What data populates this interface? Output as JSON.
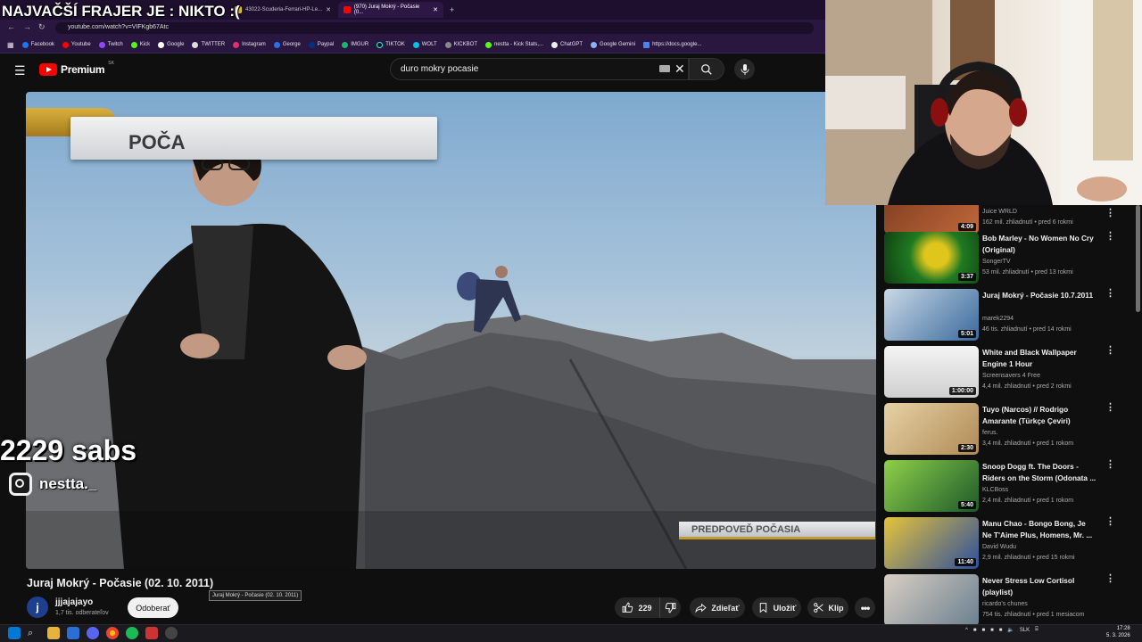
{
  "stream": {
    "title": "NAJVAČŠÍ FRAJER JE : NIKTO :(",
    "subs_counter": "2229 sabs",
    "instagram": "nestta._"
  },
  "browser": {
    "tabs": [
      {
        "label": "43022-Scuderia-Ferrari-HP-Le..."
      },
      {
        "label": "(970) Juraj Mokrý - Počasie (0..."
      }
    ],
    "url": "youtube.com/watch?v=VIFKgb67Atc",
    "bookmarks": [
      "Facebook",
      "Youtube",
      "Twitch",
      "Kick",
      "Google",
      "TWITTER",
      "Instagram",
      "George",
      "Paypal",
      "IMGUR",
      "TIKTOK",
      "WOLT",
      "KICKBOT",
      "nestta - Kick Stats,...",
      "ChatGPT",
      "Google Gemini",
      "https://docs.google..."
    ]
  },
  "youtube": {
    "logo": "Premium",
    "country": "SK",
    "search_query": "duro mokry pocasie"
  },
  "video": {
    "overlay_title": "POČA",
    "forecast_tag": "PREDPOVEĎ POČASIA",
    "title": "Juraj Mokrý - Počasie (02. 10. 2011)",
    "tooltip": "Juraj Mokrý - Počasie (02. 10. 2011)",
    "channel_initial": "j",
    "channel": "jjjajajayo",
    "channel_subs": "1,7 tis. odberateľov",
    "subscribe": "Odoberať",
    "likes": "229",
    "share": "Zdieľať",
    "save": "Uložiť",
    "clip": "Klip"
  },
  "sidebar": [
    {
      "title": "",
      "channel": "Juice WRLD",
      "meta": "162 mil. zhliadnutí • pred 6 rokmi",
      "duration": "4:09",
      "colors": [
        "#7a3b1f",
        "#c1683a"
      ]
    },
    {
      "title": "Bob Marley - No Women No Cry (Original)",
      "channel": "SongerTV",
      "meta": "53 mil. zhliadnutí • pred 13 rokmi",
      "duration": "3:37",
      "colors": [
        "#1f7a22",
        "#e0c51c"
      ]
    },
    {
      "title": "Juraj Mokrý - Počasie 10.7.2011",
      "channel": "marek2294",
      "meta": "46 tis. zhliadnutí • pred 14 rokmi",
      "duration": "5:01",
      "colors": [
        "#3a6a9c",
        "#c9d8e6"
      ]
    },
    {
      "title": "White and Black Wallpaper Engine 1 Hour",
      "channel": "Screensavers 4 Free",
      "meta": "4,4 mil. zhliadnutí • pred 2 rokmi",
      "duration": "1:00:00",
      "colors": [
        "#d8d8d8",
        "#f4f4f4"
      ]
    },
    {
      "title": "Tuyo (Narcos) // Rodrigo Amarante (Türkçe Çeviri)",
      "channel": "ferus.",
      "meta": "3,4 mil. zhliadnutí • pred 1 rokom",
      "duration": "2:30",
      "colors": [
        "#b08a55",
        "#e6d2a5"
      ]
    },
    {
      "title": "Snoop Dogg ft. The Doors - Riders on the Storm (Odonata ...",
      "channel": "KLCBoss",
      "meta": "2,4 mil. zhliadnutí • pred 1 rokom",
      "duration": "5:40",
      "colors": [
        "#1c5a2a",
        "#8fd04a"
      ]
    },
    {
      "title": "Manu Chao - Bongo Bong, Je Ne T'Aime Plus, Homens, Mr. ...",
      "channel": "David Wudu",
      "meta": "2,9 mil. zhliadnutí • pred 15 rokmi",
      "duration": "11:40",
      "colors": [
        "#2f4f9c",
        "#e5c43a"
      ]
    },
    {
      "title": "Never Stress Low Cortisol (playlist)",
      "channel": "ricardo's chunes",
      "meta": "754 tis. zhliadnutí • pred 1 mesiacom",
      "duration": "",
      "colors": [
        "#6a7f8f",
        "#d9cfc4"
      ]
    }
  ],
  "taskbar": {
    "lang": "SLK",
    "time": "17:28",
    "date": "5. 3. 2026"
  }
}
